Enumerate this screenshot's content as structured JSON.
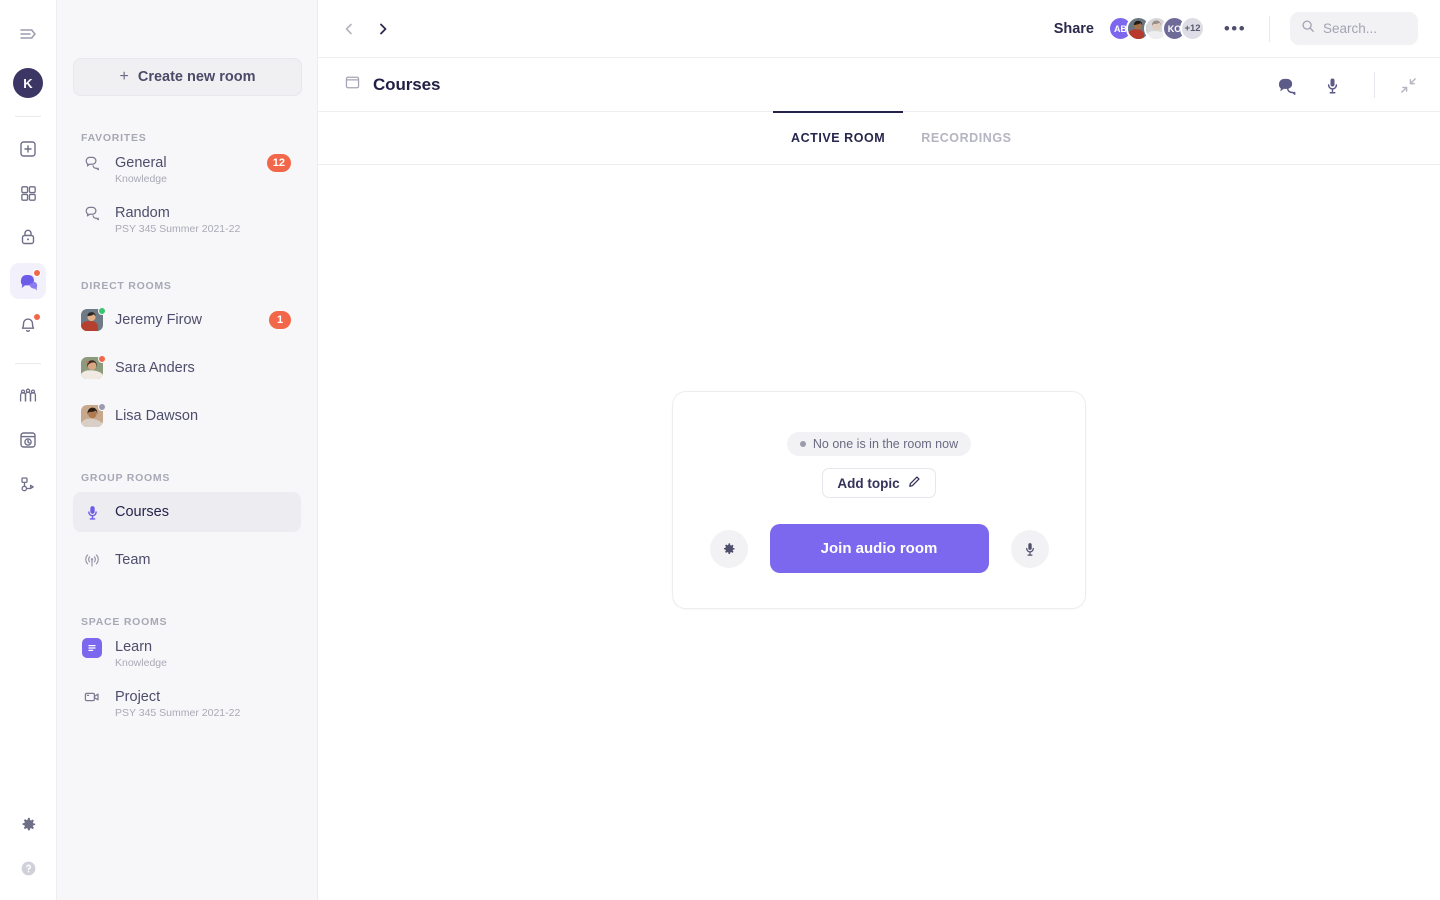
{
  "rail": {
    "collapse_icon": "collapse-panel-icon",
    "user_initial": "K",
    "items": [
      {
        "icon": "add-square-icon",
        "name": "add"
      },
      {
        "icon": "grid-apps-icon",
        "name": "apps"
      },
      {
        "icon": "lock-icon",
        "name": "privacy"
      },
      {
        "icon": "chat-bubbles-icon",
        "name": "messages",
        "active": true,
        "dot": true
      },
      {
        "icon": "bell-icon",
        "name": "notifications",
        "dot": true
      },
      {
        "icon": "people-group-icon",
        "name": "people"
      },
      {
        "icon": "clock-window-icon",
        "name": "history"
      },
      {
        "icon": "flow-nodes-icon",
        "name": "flows"
      }
    ],
    "settings_icon": "gear-icon",
    "help_icon": "help-circle-icon"
  },
  "sidebar": {
    "create_label": "Create new room",
    "sections": [
      {
        "label": "FAVORITES",
        "rooms": [
          {
            "name": "General",
            "subtitle": "Knowledge",
            "icon": "chat-bubbles-icon",
            "badge": "12"
          },
          {
            "name": "Random",
            "subtitle": "PSY 345 Summer 2021-22",
            "icon": "chat-bubbles-icon",
            "badge": ""
          }
        ]
      },
      {
        "label": "DIRECT ROOMS",
        "rooms": [
          {
            "name": "Jeremy Firow",
            "subtitle": "",
            "icon": "avatar",
            "presence": "online",
            "badge": "1"
          },
          {
            "name": "Sara Anders",
            "subtitle": "",
            "icon": "avatar",
            "presence": "busy",
            "badge": ""
          },
          {
            "name": "Lisa Dawson",
            "subtitle": "",
            "icon": "avatar",
            "presence": "away",
            "badge": ""
          }
        ]
      },
      {
        "label": "GROUP ROOMS",
        "rooms": [
          {
            "name": "Courses",
            "subtitle": "",
            "icon": "microphone-icon",
            "badge": "",
            "selected": true
          },
          {
            "name": "Team",
            "subtitle": "",
            "icon": "broadcast-icon",
            "badge": ""
          }
        ]
      },
      {
        "label": "SPACE ROOMS",
        "rooms": [
          {
            "name": "Learn",
            "subtitle": "Knowledge",
            "icon": "document-lines-icon",
            "badge": ""
          },
          {
            "name": "Project",
            "subtitle": "PSY 345 Summer 2021-22",
            "icon": "video-camera-icon",
            "badge": ""
          }
        ]
      }
    ]
  },
  "topbar": {
    "back_icon": "chevron-left-icon",
    "forward_icon": "chevron-right-icon",
    "share_label": "Share",
    "avatars": [
      {
        "label": "AB",
        "type": "initials",
        "color": "#7b68ee"
      },
      {
        "label": "",
        "type": "photo"
      },
      {
        "label": "",
        "type": "photo"
      },
      {
        "label": "KO",
        "type": "initials",
        "color": "#6f6b99"
      },
      {
        "label": "+12",
        "type": "overflow",
        "color": "#dedde5"
      }
    ],
    "more_label": "•••",
    "search": {
      "placeholder": "Search...",
      "icon": "search-icon",
      "value": ""
    }
  },
  "content_header": {
    "room_icon": "window-square-icon",
    "title": "Courses",
    "icons": [
      {
        "name": "chat-bubbles-icon"
      },
      {
        "name": "microphone-icon"
      },
      {
        "name": "collapse-diagonal-icon"
      }
    ]
  },
  "tabs": [
    {
      "label": "ACTIVE ROOM",
      "active": true
    },
    {
      "label": "RECORDINGS",
      "active": false
    }
  ],
  "room_card": {
    "status_text": "No one is in the room now",
    "status_dot_color": "#9b9bae",
    "topic_label": "Add topic",
    "topic_icon": "pencil-icon",
    "settings_icon": "gear-icon",
    "mic_icon": "microphone-icon",
    "join_label": "Join audio room",
    "join_color": "#7b68ee"
  }
}
